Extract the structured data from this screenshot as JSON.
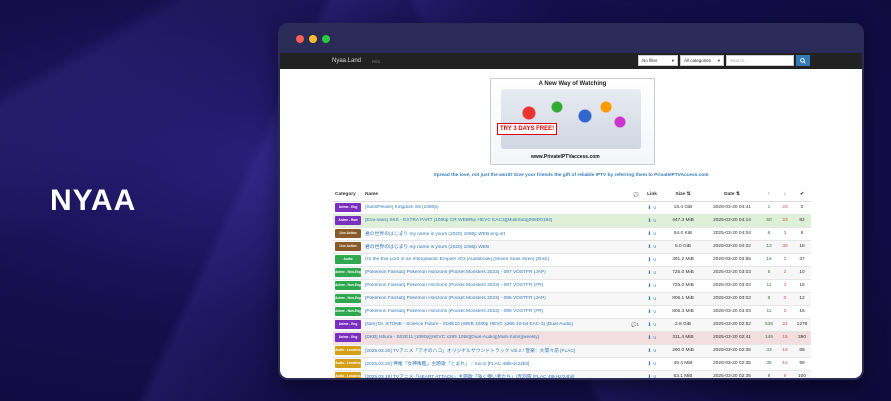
{
  "brand": "NYAA",
  "colors": {
    "background": "#160f4f",
    "accent": "#337ab7",
    "window": "#2b2b57"
  },
  "browser": {
    "nav": {
      "brand": "Nyaa.Land",
      "rss": "RSS",
      "filter_value": "No filter",
      "category_value": "All categories",
      "search_placeholder": "Search...",
      "search_icon": "search-icon"
    },
    "ad": {
      "title": "A New Way of Watching",
      "trial": "TRY 3 DAYS FREE!",
      "url": "www.PrivateIPTVaccess.com"
    },
    "promo_text": "Spread the love, not just the word! Give your friends the gift of reliable IPTV by referring them to PrivateIPTVAccess.com",
    "table": {
      "headers": {
        "category": "Category",
        "name": "Name",
        "link": "Link",
        "size": "Size",
        "date": "Date"
      },
      "rows": [
        {
          "cat": "Anime - Eng",
          "cat_color": "#7a2fbf",
          "name": "[SubsPlease] Kingdom S5 (1080p)",
          "size": "18.4 GiB",
          "date": "2025-03-20 04:41",
          "seeders": "1",
          "leechers": "23",
          "completed": "0",
          "comments": "",
          "status": "default"
        },
        {
          "cat": "Anime - Raw",
          "cat_color": "#7a2fbf",
          "name": "[Erai-raws] SKS - EXTRA PART [1080p CR WEBRip HEVC EAC3][MultiSub][068D0194]",
          "size": "447.3 MiB",
          "date": "2025-03-20 04:14",
          "seeders": "50",
          "leechers": "23",
          "completed": "82",
          "comments": "",
          "status": "success"
        },
        {
          "cat": "Live Action",
          "cat_color": "#8a5a2b",
          "name": "君の世界のはじまり my name is yours (2020) 1080p WEB eng srt",
          "size": "64.0 KiB",
          "date": "2025-03-20 04:04",
          "seeders": "6",
          "leechers": "3",
          "completed": "6",
          "comments": "",
          "status": "default"
        },
        {
          "cat": "Live Action",
          "cat_color": "#8a5a2b",
          "name": "君の世界のはじまり my name is yours (2020) 1080p WEB",
          "size": "5.0 GiB",
          "date": "2025-03-20 04:02",
          "seeders": "13",
          "leechers": "39",
          "completed": "18",
          "comments": "",
          "status": "default"
        },
        {
          "cat": "Audio",
          "cat_color": "#2fa84f",
          "name": "I'm the Evil Lord of an Intergalactic Empire! v01 [Audiobook] [Seven Seas Siren] [Stick]",
          "size": "391.2 MiB",
          "date": "2025-03-20 03:55",
          "seeders": "16",
          "leechers": "2",
          "completed": "37",
          "comments": "",
          "status": "default"
        },
        {
          "cat": "Anime - Non-Eng",
          "cat_color": "#2fa84f",
          "name": "[Pokémon Fansub] Pokémon Horizons (Pocket Monsters 2023) - 087 VOSTFR (JAP)",
          "size": "725.0 MiB",
          "date": "2025-03-20 03:03",
          "seeders": "5",
          "leechers": "2",
          "completed": "10",
          "comments": "",
          "status": "default"
        },
        {
          "cat": "Anime - Non-Eng",
          "cat_color": "#2fa84f",
          "name": "[Pokémon Fansub] Pokémon Horizons (Pocket Monsters 2023) - 087 VOSTFR (FR)",
          "size": "725.0 MiB",
          "date": "2025-03-20 03:03",
          "seeders": "11",
          "leechers": "3",
          "completed": "15",
          "comments": "",
          "status": "default"
        },
        {
          "cat": "Anime - Non-Eng",
          "cat_color": "#2fa84f",
          "name": "[Pokémon Fansub] Pokémon Horizons (Pocket Monsters 2023) - 086 VOSTFR (JAP)",
          "size": "806.1 MiB",
          "date": "2025-03-20 03:03",
          "seeders": "6",
          "leechers": "0",
          "completed": "12",
          "comments": "",
          "status": "default"
        },
        {
          "cat": "Anime - Non-Eng",
          "cat_color": "#2fa84f",
          "name": "[Pokémon Fansub] Pokémon Horizons (Pocket Monsters 2023) - 086 VOSTFR (FR)",
          "size": "806.3 MiB",
          "date": "2025-03-20 03:03",
          "seeders": "11",
          "leechers": "2",
          "completed": "16",
          "comments": "",
          "status": "default"
        },
        {
          "cat": "Anime - Eng",
          "cat_color": "#7a2fbf",
          "name": "[sam] Dr. STONE - Science Future - S04E10 (WEB 1080p HEVC x265 10-bit EAC-3) [Dual-Audio]",
          "size": "2.8 GiB",
          "date": "2025-03-20 02:52",
          "seeders": "636",
          "leechers": "24",
          "completed": "1278",
          "comments": "1",
          "status": "default"
        },
        {
          "cat": "Anime - Eng",
          "cat_color": "#7a2fbf",
          "name": "[DKB] Ishura - S02E11 [1080p][HEVC x265 10bit][Dual-Audio][Multi-Subs][weekly]",
          "size": "311.4 MiB",
          "date": "2025-03-20 02:41",
          "seeders": "146",
          "leechers": "15",
          "completed": "390",
          "comments": "",
          "status": "danger"
        },
        {
          "cat": "Audio - Lossless",
          "cat_color": "#d4a017",
          "name": "[2025.03.20] TVアニメ「アオのハコ」オリジナルサウンドトラック Vol.2 / 音楽：大間々昂 [FLAC]",
          "size": "290.0 MiB",
          "date": "2025-03-20 02:35",
          "seeders": "33",
          "leechers": "16",
          "completed": "86",
          "comments": "",
          "status": "default"
        },
        {
          "cat": "Audio - Lossless",
          "cat_color": "#d4a017",
          "name": "[2025.03.20] 神尾「女神降臨」主題歌「とまれ」／Xucci [FLAC 48kHz/24bit]",
          "size": "49.4 MiB",
          "date": "2025-03-20 02:35",
          "seeders": "36",
          "leechers": "12",
          "completed": "99",
          "comments": "",
          "status": "default"
        },
        {
          "cat": "Audio - Lossless",
          "cat_color": "#d4a017",
          "name": "[2025.03.19] TVアニメ「HEART ATTACK」主題歌「強く儚い者たち」/赤羽雷 [FLAC 48kHz/24bit]",
          "size": "53.1 MiB",
          "date": "2025-03-20 02:35",
          "seeders": "8",
          "leechers": "9",
          "completed": "100",
          "comments": "",
          "status": "default"
        }
      ]
    }
  }
}
